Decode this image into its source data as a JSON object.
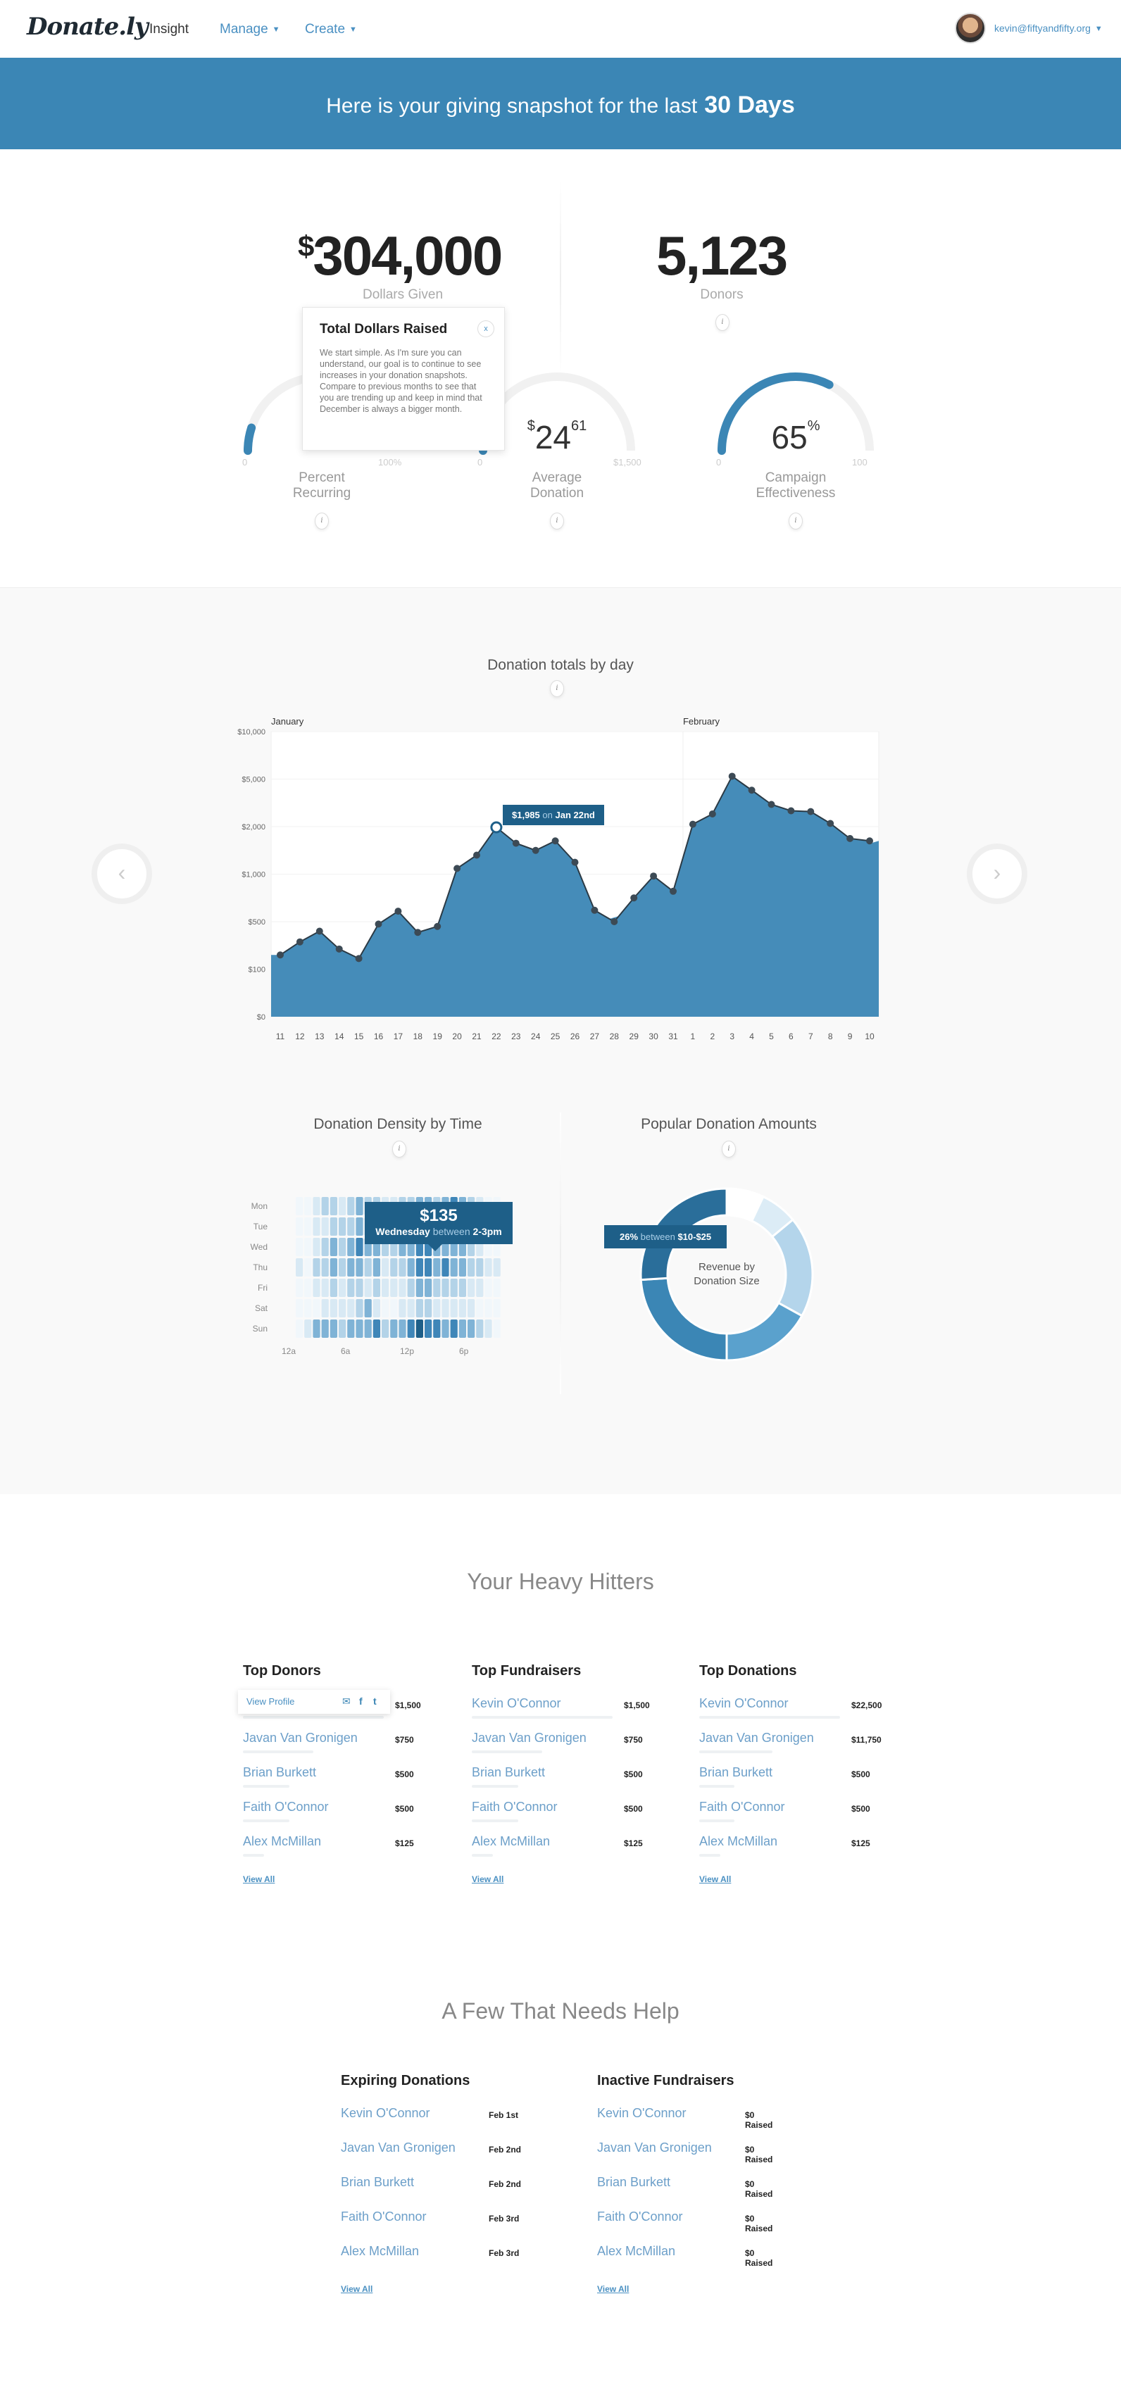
{
  "nav": {
    "logo": "Donate.ly",
    "insight": "Insight",
    "manage": "Manage",
    "create": "Create",
    "user_email": "kevin@fiftyandfifty.org"
  },
  "banner": {
    "prefix": "Here is your giving snapshot for the last",
    "period": "30 Days"
  },
  "stats": {
    "dollars": {
      "currency": "$",
      "value": "304,000",
      "label": "Dollars Given"
    },
    "donors": {
      "value": "5,123",
      "label": "Donors"
    }
  },
  "tooltip": {
    "title": "Total Dollars Raised",
    "close_icon": "x",
    "body": "We start simple. As I'm sure you can understand, our goal is to continue to see increases in your donation snapshots. Compare to previous months to see that you are trending up and keep in mind that December is always a bigger month."
  },
  "gauges": [
    {
      "label1": "Percent",
      "label2": "Recurring",
      "min": "0",
      "max": "100%",
      "fraction": 0.1
    },
    {
      "label1": "Average",
      "label2": "Donation",
      "value_prefix": "$",
      "value": "24",
      "value_cents": "61",
      "min": "0",
      "max": "$1,500",
      "fraction": 0.02
    },
    {
      "label1": "Campaign",
      "label2": "Effectiveness",
      "value": "65",
      "value_suffix": "%",
      "min": "0",
      "max": "100",
      "fraction": 0.65
    }
  ],
  "colors": {
    "accent": "#3b86b5",
    "dark_accent": "#1e5f88",
    "link": "#4a90c2"
  },
  "chart_section": {
    "title": "Donation totals by day",
    "prev_icon": "‹",
    "next_icon": "›",
    "tooltip": {
      "amount": "$1,985",
      "on": "on",
      "date": "Jan 22nd"
    }
  },
  "chart_data": {
    "type": "area",
    "title": "Donation totals by day",
    "months": [
      {
        "label": "January",
        "at": "11"
      },
      {
        "label": "February",
        "at": "1"
      }
    ],
    "y_tick_labels": [
      "$10,000",
      "$5,000",
      "$2,000",
      "$1,000",
      "$500",
      "$100",
      "$0"
    ],
    "x": [
      "11",
      "12",
      "13",
      "14",
      "15",
      "16",
      "17",
      "18",
      "19",
      "20",
      "21",
      "22",
      "23",
      "24",
      "25",
      "26",
      "27",
      "28",
      "29",
      "30",
      "31",
      "1",
      "2",
      "3",
      "4",
      "5",
      "6",
      "7",
      "8",
      "9",
      "10"
    ],
    "values": [
      220,
      330,
      420,
      270,
      190,
      480,
      610,
      410,
      460,
      1120,
      1400,
      1985,
      1650,
      1500,
      1700,
      1250,
      620,
      500,
      750,
      980,
      820,
      2150,
      2800,
      5300,
      4300,
      3400,
      3000,
      2950,
      2200,
      1750,
      1700
    ],
    "highlight_index": 11
  },
  "density": {
    "title": "Donation Density by Time",
    "days": [
      "Mon",
      "Tue",
      "Wed",
      "Thu",
      "Fri",
      "Sat",
      "Sun"
    ],
    "hours": [
      "12a",
      "6a",
      "12p",
      "6p"
    ],
    "tooltip": {
      "amount": "$135",
      "day": "Wednesday",
      "between": "between",
      "range": "2-3pm"
    },
    "levels": [
      [
        0,
        0,
        1,
        2,
        2,
        1,
        2,
        3,
        2,
        2,
        1,
        1,
        2,
        2,
        3,
        3,
        2,
        3,
        4,
        3,
        2,
        1,
        0,
        0
      ],
      [
        0,
        0,
        1,
        1,
        2,
        2,
        2,
        3,
        2,
        2,
        2,
        1,
        2,
        3,
        3,
        4,
        3,
        3,
        3,
        2,
        2,
        1,
        0,
        0
      ],
      [
        0,
        0,
        1,
        2,
        3,
        2,
        3,
        4,
        3,
        3,
        2,
        2,
        3,
        3,
        4,
        4,
        3,
        3,
        3,
        3,
        2,
        1,
        0,
        0
      ],
      [
        1,
        0,
        2,
        2,
        3,
        2,
        3,
        3,
        2,
        3,
        1,
        2,
        2,
        3,
        4,
        4,
        3,
        4,
        3,
        3,
        2,
        2,
        1,
        1
      ],
      [
        0,
        0,
        1,
        1,
        2,
        1,
        2,
        2,
        1,
        2,
        1,
        1,
        1,
        2,
        3,
        3,
        2,
        2,
        2,
        2,
        1,
        1,
        0,
        0
      ],
      [
        0,
        0,
        0,
        1,
        1,
        1,
        1,
        2,
        3,
        1,
        0,
        0,
        1,
        1,
        2,
        2,
        1,
        1,
        1,
        1,
        1,
        0,
        0,
        0
      ],
      [
        0,
        1,
        3,
        3,
        3,
        2,
        3,
        3,
        3,
        4,
        2,
        3,
        3,
        4,
        5,
        4,
        4,
        3,
        4,
        3,
        3,
        2,
        1,
        0
      ]
    ]
  },
  "donut": {
    "title": "Popular Donation Amounts",
    "center1": "Revenue by",
    "center2": "Donation Size",
    "tooltip": {
      "pct": "26%",
      "between": "between",
      "range": "$10-$25"
    },
    "slices": [
      {
        "value": 7,
        "color": "#ffffff"
      },
      {
        "value": 7,
        "color": "#dcecf6"
      },
      {
        "value": 19,
        "color": "#b4d5eb"
      },
      {
        "value": 17,
        "color": "#5aa1cd"
      },
      {
        "value": 24,
        "color": "#3b86b5"
      },
      {
        "value": 26,
        "color": "#2a6e9a"
      }
    ]
  },
  "heavy_hitters": {
    "title": "Your Heavy Hitters",
    "profile_popup": {
      "label": "View Profile"
    },
    "columns": [
      {
        "title": "Top Donors",
        "rows": [
          {
            "name": "Kevin O'Connor",
            "amount": "$1,500",
            "bar": 1.0
          },
          {
            "name": "Javan Van Gronigen",
            "amount": "$750",
            "bar": 0.5
          },
          {
            "name": "Brian Burkett",
            "amount": "$500",
            "bar": 0.33
          },
          {
            "name": "Faith O'Connor",
            "amount": "$500",
            "bar": 0.33
          },
          {
            "name": "Alex McMillan",
            "amount": "$125",
            "bar": 0.15
          }
        ],
        "view_all": "View All"
      },
      {
        "title": "Top Fundraisers",
        "rows": [
          {
            "name": "Kevin O'Connor",
            "amount": "$1,500",
            "bar": 1.0
          },
          {
            "name": "Javan Van Gronigen",
            "amount": "$750",
            "bar": 0.5
          },
          {
            "name": "Brian Burkett",
            "amount": "$500",
            "bar": 0.33
          },
          {
            "name": "Faith O'Connor",
            "amount": "$500",
            "bar": 0.33
          },
          {
            "name": "Alex McMillan",
            "amount": "$125",
            "bar": 0.15
          }
        ],
        "view_all": "View All"
      },
      {
        "title": "Top Donations",
        "rows": [
          {
            "name": "Kevin O'Connor",
            "amount": "$22,500",
            "bar": 1.0
          },
          {
            "name": "Javan Van Gronigen",
            "amount": "$11,750",
            "bar": 0.52
          },
          {
            "name": "Brian Burkett",
            "amount": "$500",
            "bar": 0.25
          },
          {
            "name": "Faith O'Connor",
            "amount": "$500",
            "bar": 0.25
          },
          {
            "name": "Alex McMillan",
            "amount": "$125",
            "bar": 0.15
          }
        ],
        "view_all": "View All"
      }
    ]
  },
  "needs_help": {
    "title": "A Few That Needs Help",
    "columns": [
      {
        "title": "Expiring Donations",
        "rows": [
          {
            "name": "Kevin O'Connor",
            "value": "Feb 1st"
          },
          {
            "name": "Javan Van Gronigen",
            "value": "Feb 2nd"
          },
          {
            "name": "Brian Burkett",
            "value": "Feb 2nd"
          },
          {
            "name": "Faith O'Connor",
            "value": "Feb 3rd"
          },
          {
            "name": "Alex McMillan",
            "value": "Feb 3rd"
          }
        ],
        "view_all": "View All"
      },
      {
        "title": "Inactive Fundraisers",
        "rows": [
          {
            "name": "Kevin O'Connor",
            "value": "$0 Raised"
          },
          {
            "name": "Javan Van Gronigen",
            "value": "$0 Raised"
          },
          {
            "name": "Brian Burkett",
            "value": "$0 Raised"
          },
          {
            "name": "Faith O'Connor",
            "value": "$0 Raised"
          },
          {
            "name": "Alex McMillan",
            "value": "$0 Raised"
          }
        ],
        "view_all": "View All"
      }
    ]
  }
}
